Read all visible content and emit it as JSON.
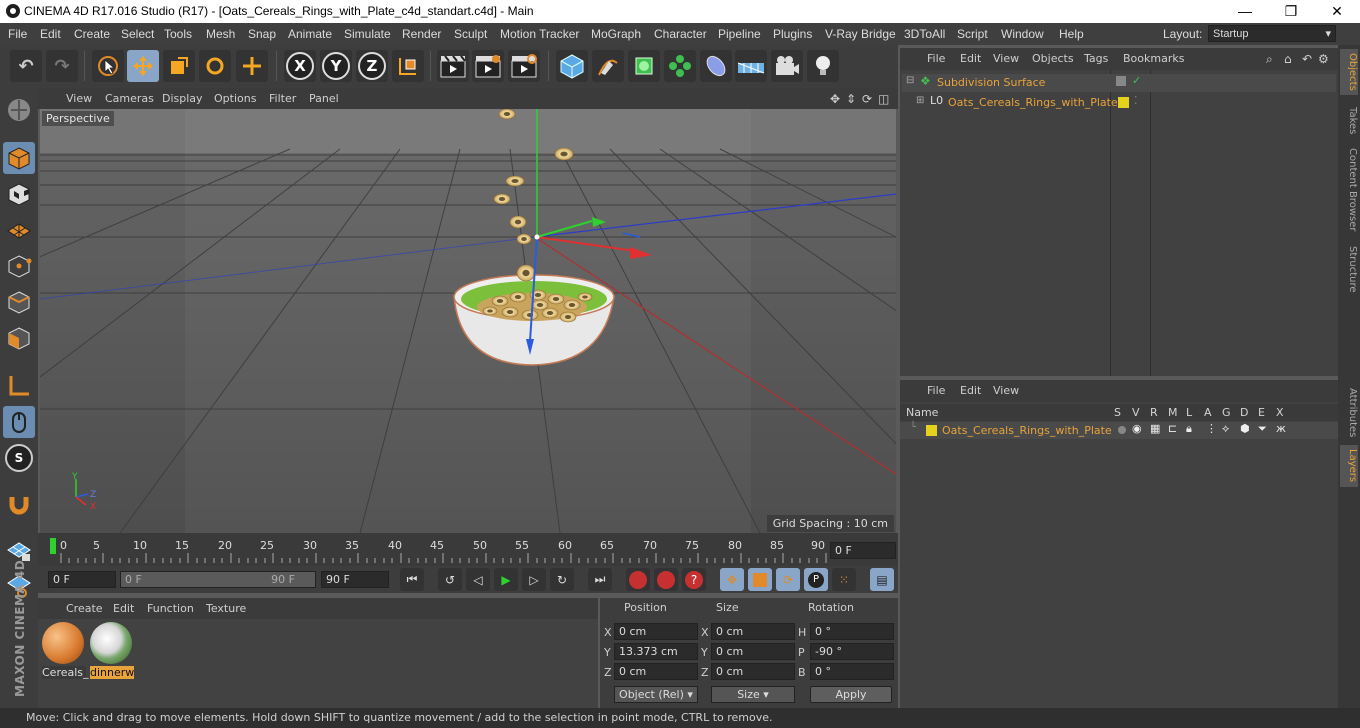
{
  "window": {
    "title": "CINEMA 4D R17.016 Studio (R17) - [Oats_Cereals_Rings_with_Plate_c4d_standart.c4d] - Main",
    "minimize": "—",
    "maximize": "❐",
    "close": "✕"
  },
  "menubar": {
    "items": [
      "File",
      "Edit",
      "Create",
      "Select",
      "Tools",
      "Mesh",
      "Snap",
      "Animate",
      "Simulate",
      "Render",
      "Sculpt",
      "Motion Tracker",
      "MoGraph",
      "Character",
      "Pipeline",
      "Plugins",
      "V-Ray Bridge",
      "3DToAll",
      "Script",
      "Window",
      "Help"
    ],
    "layout_label": "Layout:",
    "layout_value": "Startup"
  },
  "toolbar": {
    "axis_x": "X",
    "axis_y": "Y",
    "axis_z": "Z"
  },
  "viewport": {
    "menu": [
      "View",
      "Cameras",
      "Display",
      "Options",
      "Filter",
      "Panel"
    ],
    "camera_label": "Perspective",
    "grid_spacing": "Grid Spacing : 10 cm",
    "axis_y": "Y",
    "axis_x": "X",
    "axis_z": "Z"
  },
  "timeline": {
    "ticks": [
      "0",
      "5",
      "10",
      "15",
      "20",
      "25",
      "30",
      "35",
      "40",
      "45",
      "50",
      "55",
      "60",
      "65",
      "70",
      "75",
      "80",
      "85",
      "90"
    ],
    "current_frame": "0 F"
  },
  "playback": {
    "start": "0 F",
    "range_start": "0 F",
    "range_end": "90 F",
    "end": "90 F"
  },
  "materials": {
    "menu": [
      "Create",
      "Edit",
      "Function",
      "Texture"
    ],
    "items": [
      {
        "name": "Cereals_"
      },
      {
        "name": "dinnerw"
      }
    ]
  },
  "coords": {
    "headers": {
      "position": "Position",
      "size": "Size",
      "rotation": "Rotation"
    },
    "rows": [
      {
        "axis": "X",
        "pos": "0 cm",
        "size_axis": "X",
        "size": "0 cm",
        "rot_axis": "H",
        "rot": "0 °"
      },
      {
        "axis": "Y",
        "pos": "13.373 cm",
        "size_axis": "Y",
        "size": "0 cm",
        "rot_axis": "P",
        "rot": "-90 °"
      },
      {
        "axis": "Z",
        "pos": "0 cm",
        "size_axis": "Z",
        "size": "0 cm",
        "rot_axis": "B",
        "rot": "0 °"
      }
    ],
    "mode": "Object (Rel)",
    "size_mode": "Size",
    "apply": "Apply"
  },
  "objects": {
    "menu": [
      "File",
      "Edit",
      "View",
      "Objects",
      "Tags",
      "Bookmarks"
    ],
    "items": [
      {
        "name": "Subdivision Surface"
      },
      {
        "name": "Oats_Cereals_Rings_with_Plate"
      }
    ]
  },
  "layers": {
    "menu": [
      "File",
      "Edit",
      "View"
    ],
    "header_name": "Name",
    "columns": [
      "S",
      "V",
      "R",
      "M",
      "L",
      "A",
      "G",
      "D",
      "E",
      "X"
    ],
    "row_name": "Oats_Cereals_Rings_with_Plate"
  },
  "side_tabs": [
    "Objects",
    "Takes",
    "Content Browser",
    "Structure",
    "Attributes",
    "Layers"
  ],
  "branding": "MAXON CINEMA 4D",
  "status": "Move: Click and drag to move elements. Hold down SHIFT to quantize movement / add to the selection in point mode, CTRL to remove.",
  "colors": {
    "accent_orange": "#e8a33a",
    "layer_yellow": "#e5d21c",
    "selection_blue": "#89a6c8"
  }
}
